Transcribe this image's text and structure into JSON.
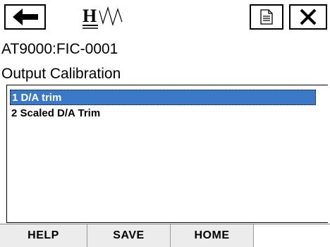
{
  "header": {
    "back_icon": "arrow-left-icon",
    "logo": "HART-logo",
    "logo_letter": "H",
    "doc_icon": "document-icon",
    "close_icon": "close-icon"
  },
  "device": {
    "tag": "AT9000:FIC-0001"
  },
  "menu": {
    "title": "Output Calibration",
    "items": [
      {
        "label": "1 D/A trim",
        "selected": true
      },
      {
        "label": "2 Scaled D/A Trim",
        "selected": false
      }
    ],
    "selection_color": "#3a78c8"
  },
  "softkeys": [
    {
      "label": "HELP"
    },
    {
      "label": "SAVE"
    },
    {
      "label": "HOME"
    },
    {
      "label": ""
    }
  ]
}
